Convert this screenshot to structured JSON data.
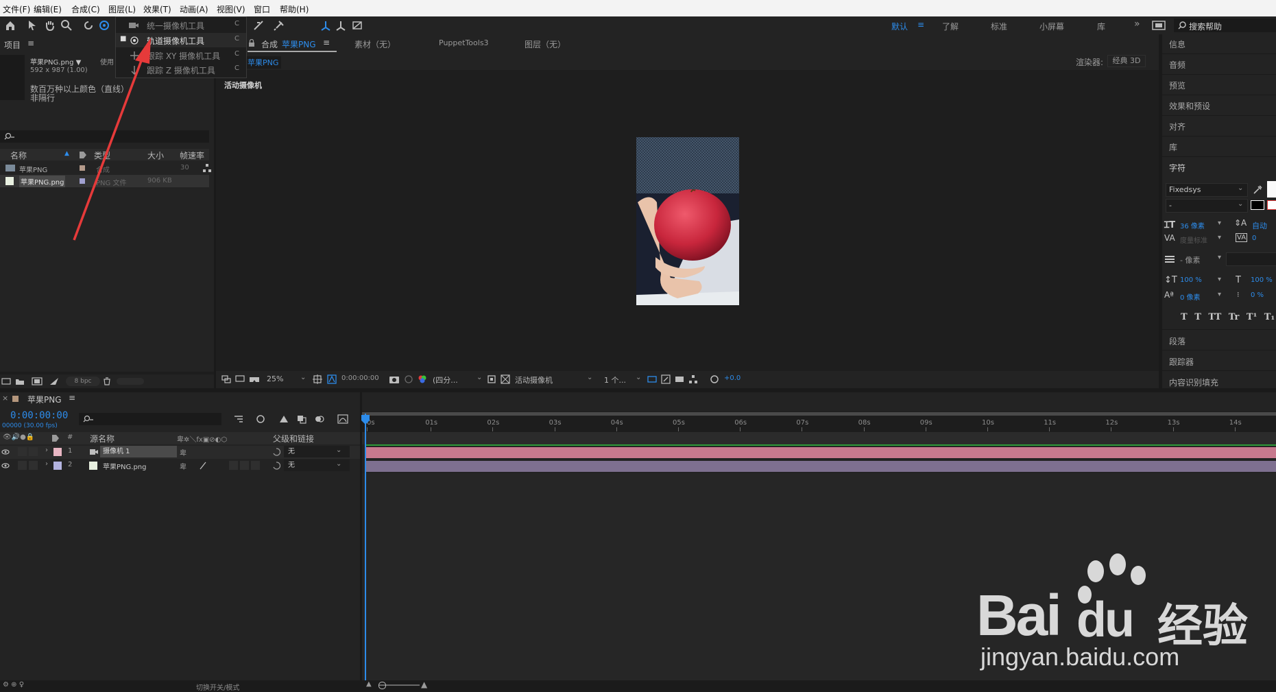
{
  "menu": [
    "文件(F)",
    "编辑(E)",
    "合成(C)",
    "图层(L)",
    "效果(T)",
    "动画(A)",
    "视图(V)",
    "窗口",
    "帮助(H)"
  ],
  "workspaces": {
    "active": "默认",
    "items": [
      "了解",
      "标准",
      "小屏幕",
      "库"
    ]
  },
  "search_help": "搜索帮助",
  "camera_menu": [
    {
      "label": "统一摄像机工具",
      "shortcut": "C",
      "selected": false
    },
    {
      "label": "轨道摄像机工具",
      "shortcut": "C",
      "selected": true
    },
    {
      "label": "跟踪 XY 摄像机工具",
      "shortcut": "C",
      "selected": false
    },
    {
      "label": "跟踪 Z 摄像机工具",
      "shortcut": "C",
      "selected": false
    }
  ],
  "project": {
    "title": "项目",
    "item_name": "苹果PNG.png ▼",
    "item_used": "使用",
    "item_dims": "592 x 987 (1.00)",
    "item_desc1": "数百万种以上颜色（直线）",
    "item_desc2": "非隔行",
    "columns": {
      "name": "名称",
      "type": "类型",
      "size": "大小",
      "fps": "帧速率"
    },
    "rows": [
      {
        "name": "苹果PNG",
        "type": "合成",
        "size": "",
        "fps": "30"
      },
      {
        "name": "苹果PNG.png",
        "type": "PNG 文件",
        "size": "906 KB",
        "fps": ""
      }
    ],
    "bpc": "8 bpc"
  },
  "viewer": {
    "tab_comp_prefix": "合成",
    "tab_comp_name": "苹果PNG",
    "tab_footage": "素材（无）",
    "tab_puppet": "PuppetTools3",
    "tab_layer": "图层（无）",
    "sub_tab": "苹果PNG",
    "renderer_label": "渲染器:",
    "renderer_value": "经典 3D",
    "active_camera_label": "活动摄像机",
    "zoom": "25%",
    "timecode": "0:00:00:00",
    "resolution": "(四分...",
    "camera_view": "活动摄像机",
    "views": "1 个...",
    "exposure": "+0.0"
  },
  "timeline": {
    "comp_name": "苹果PNG",
    "timecode": "0:00:00:00",
    "fps_info": "00000 (30.00 fps)",
    "col_source": "源名称",
    "col_parent": "父级和链接",
    "layers": [
      {
        "num": "1",
        "name": "摄像机 1",
        "parent": "无",
        "label_color": "#e8b6c3"
      },
      {
        "num": "2",
        "name": "苹果PNG.png",
        "parent": "无",
        "label_color": "#b4b4e0"
      }
    ],
    "ticks": [
      "0s",
      "01s",
      "02s",
      "03s",
      "04s",
      "05s",
      "06s",
      "07s",
      "08s",
      "09s",
      "10s",
      "11s",
      "12s",
      "13s",
      "14s"
    ],
    "footer_toggle": "切换开关/模式"
  },
  "right_panels": [
    "信息",
    "音频",
    "预览",
    "效果和预设",
    "对齐",
    "库",
    "字符"
  ],
  "character": {
    "font": "Fixedsys",
    "style": "-",
    "size": "36 像素",
    "leading": "自动",
    "kerning": "度量标准",
    "tracking": "0",
    "stroke": "- 像素",
    "vscale": "100 %",
    "hscale": "100 %",
    "baseline": "0 像素",
    "tsume": "0 %",
    "styles": "T T TT Tr T¹ T₁"
  },
  "right_panels_bottom": [
    "段落",
    "跟踪器",
    "内容识别填充"
  ],
  "watermark": {
    "brand": "Bai",
    "brand2": "du",
    "cn": "经验",
    "url": "jingyan.baidu.com"
  },
  "colors": {
    "accent": "#2d8ceb",
    "arrow": "#e63a3a",
    "camera_bar": "#c8798e",
    "png_bar": "#7e7090"
  }
}
